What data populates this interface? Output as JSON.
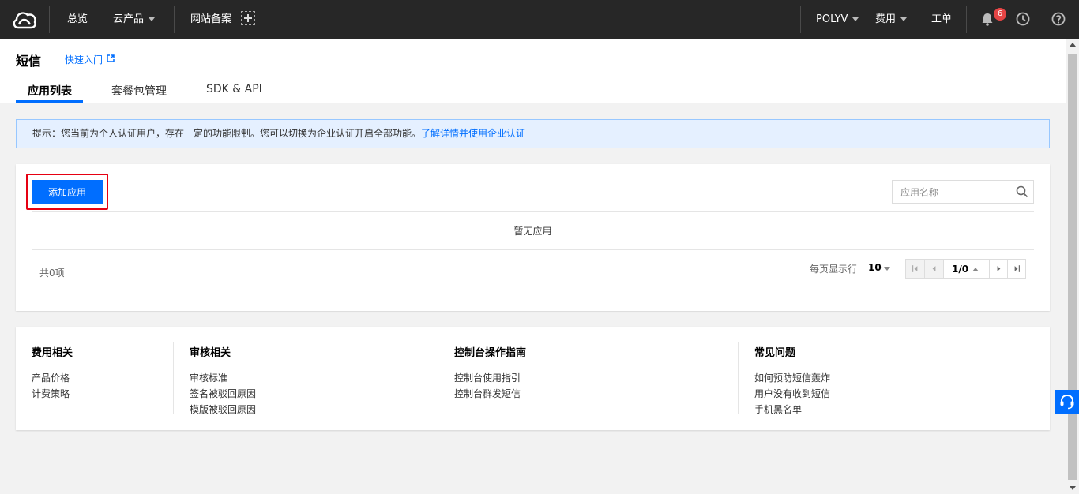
{
  "topnav": {
    "overview": "总览",
    "products": "云产品",
    "icp": "网站备案",
    "account": "POLYV",
    "billing": "费用",
    "ticket": "工单",
    "notification_count": "6"
  },
  "header": {
    "title": "短信",
    "quick_start": "快速入门",
    "tabs": [
      {
        "label": "应用列表"
      },
      {
        "label": "套餐包管理"
      },
      {
        "label": "SDK & API"
      }
    ]
  },
  "notice": {
    "text": "提示：您当前为个人认证用户，存在一定的功能限制。您可以切换为企业认证开启全部功能。",
    "link": "了解详情并使用企业认证"
  },
  "main": {
    "add_button": "添加应用",
    "search_placeholder": "应用名称",
    "empty": "暂无应用",
    "total": "共0项",
    "per_page_label": "每页显示行",
    "per_page_value": "10",
    "page_indicator": "1/0"
  },
  "footer": {
    "columns": [
      {
        "title": "费用相关",
        "links": [
          "产品价格",
          "计费策略"
        ]
      },
      {
        "title": "审核相关",
        "links": [
          "审核标准",
          "签名被驳回原因",
          "模版被驳回原因"
        ]
      },
      {
        "title": "控制台操作指南",
        "links": [
          "控制台使用指引",
          "控制台群发短信"
        ]
      },
      {
        "title": "常见问题",
        "links": [
          "如何预防短信轰炸",
          "用户没有收到短信",
          "手机黑名单"
        ]
      }
    ]
  },
  "colors": {
    "accent": "#006eff",
    "topnav_bg": "#272727",
    "highlight": "#e60012",
    "badge": "#e54545"
  }
}
